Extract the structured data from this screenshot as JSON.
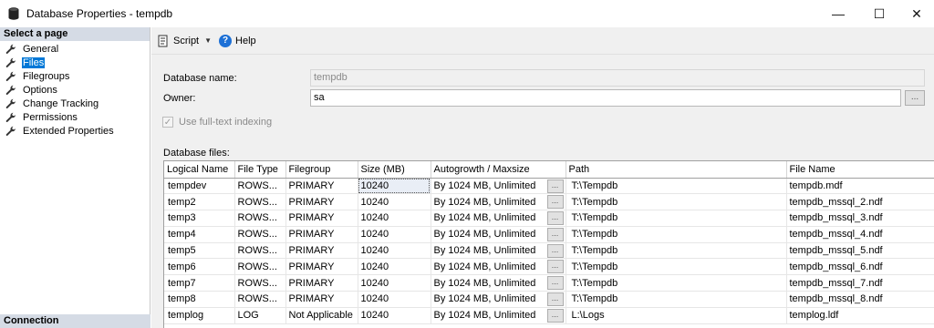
{
  "window": {
    "title": "Database Properties - tempdb",
    "minimize": "—",
    "maximize": "☐",
    "close": "✕"
  },
  "left_pane": {
    "header": "Select a page",
    "items": [
      {
        "label": "General"
      },
      {
        "label": "Files"
      },
      {
        "label": "Filegroups"
      },
      {
        "label": "Options"
      },
      {
        "label": "Change Tracking"
      },
      {
        "label": "Permissions"
      },
      {
        "label": "Extended Properties"
      }
    ],
    "selected_index": 1,
    "connection_header": "Connection"
  },
  "toolbar": {
    "script_label": "Script",
    "help_label": "Help"
  },
  "form": {
    "db_name_label": "Database name:",
    "db_name_value": "tempdb",
    "owner_label": "Owner:",
    "owner_value": "sa",
    "owner_browse": "...",
    "fulltext_label": "Use full-text indexing",
    "fulltext_checked": true,
    "db_files_label": "Database files:"
  },
  "grid": {
    "columns": [
      "Logical Name",
      "File Type",
      "Filegroup",
      "Size (MB)",
      "Autogrowth / Maxsize",
      "Path",
      "File Name"
    ],
    "rows": [
      {
        "logical": "tempdev",
        "type": "ROWS...",
        "filegroup": "PRIMARY",
        "size": "10240",
        "autogrowth": "By 1024 MB, Unlimited",
        "path": "T:\\Tempdb",
        "file": "tempdb.mdf"
      },
      {
        "logical": "temp2",
        "type": "ROWS...",
        "filegroup": "PRIMARY",
        "size": "10240",
        "autogrowth": "By 1024 MB, Unlimited",
        "path": "T:\\Tempdb",
        "file": "tempdb_mssql_2.ndf"
      },
      {
        "logical": "temp3",
        "type": "ROWS...",
        "filegroup": "PRIMARY",
        "size": "10240",
        "autogrowth": "By 1024 MB, Unlimited",
        "path": "T:\\Tempdb",
        "file": "tempdb_mssql_3.ndf"
      },
      {
        "logical": "temp4",
        "type": "ROWS...",
        "filegroup": "PRIMARY",
        "size": "10240",
        "autogrowth": "By 1024 MB, Unlimited",
        "path": "T:\\Tempdb",
        "file": "tempdb_mssql_4.ndf"
      },
      {
        "logical": "temp5",
        "type": "ROWS...",
        "filegroup": "PRIMARY",
        "size": "10240",
        "autogrowth": "By 1024 MB, Unlimited",
        "path": "T:\\Tempdb",
        "file": "tempdb_mssql_5.ndf"
      },
      {
        "logical": "temp6",
        "type": "ROWS...",
        "filegroup": "PRIMARY",
        "size": "10240",
        "autogrowth": "By 1024 MB, Unlimited",
        "path": "T:\\Tempdb",
        "file": "tempdb_mssql_6.ndf"
      },
      {
        "logical": "temp7",
        "type": "ROWS...",
        "filegroup": "PRIMARY",
        "size": "10240",
        "autogrowth": "By 1024 MB, Unlimited",
        "path": "T:\\Tempdb",
        "file": "tempdb_mssql_7.ndf"
      },
      {
        "logical": "temp8",
        "type": "ROWS...",
        "filegroup": "PRIMARY",
        "size": "10240",
        "autogrowth": "By 1024 MB, Unlimited",
        "path": "T:\\Tempdb",
        "file": "tempdb_mssql_8.ndf"
      },
      {
        "logical": "templog",
        "type": "LOG",
        "filegroup": "Not Applicable",
        "size": "10240",
        "autogrowth": "By 1024 MB, Unlimited",
        "path": "L:\\Logs",
        "file": "templog.ldf"
      }
    ],
    "browse_label": "...",
    "active_row": 0
  },
  "colors": {
    "selection": "#0078d7",
    "pane_header": "#d5dbe5",
    "help_icon": "#1d70d6"
  },
  "icons": {
    "app": "database-icon",
    "page": "wrench-icon",
    "script": "script-icon",
    "help": "help-icon"
  }
}
